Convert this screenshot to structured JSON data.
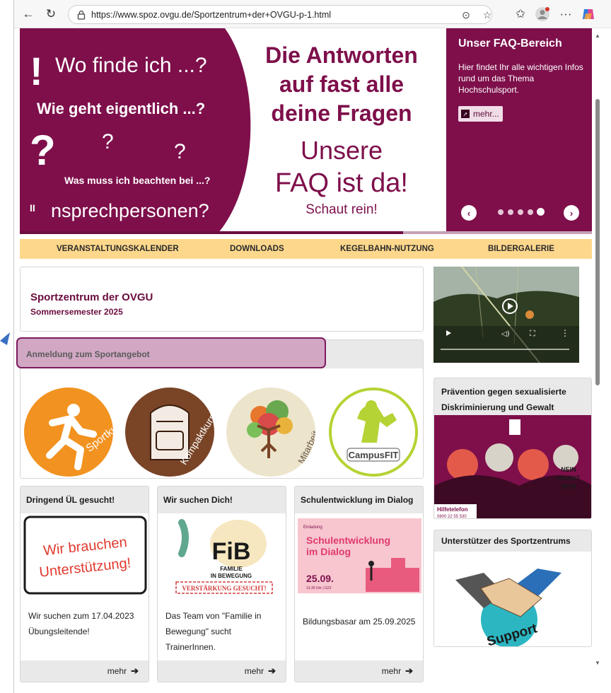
{
  "browser": {
    "url": "https://www.spoz.ovgu.de/Sportzentrum+der+OVGU-p-1.html"
  },
  "hero": {
    "line1": "Wo finde ich ...?",
    "line2": "Wie geht eigentlich ...?",
    "q_marks": [
      "?",
      "?",
      "?"
    ],
    "line3": "Was muss ich beachten bei ...?",
    "line4": "nsprechpersonen?",
    "exclaim": "!",
    "headline": [
      "Die Antworten",
      "auf fast alle",
      "deine Fragen"
    ],
    "faq_line1": "Unsere",
    "faq_line2": "FAQ ist da!",
    "faq_line3": "Schaut rein!",
    "pause_glyph": "II"
  },
  "faq_panel": {
    "title": "Unser FAQ-Bereich",
    "description": "Hier findet Ihr alle wichtigen Infos rund um das Thema Hochschulsport.",
    "more_label": "mehr...",
    "dots": 5,
    "active_dot": 4,
    "progress": 0.67
  },
  "nav": {
    "items": [
      "VERANSTALTUNGSKALENDER",
      "DOWNLOADS",
      "KEGELBAHN-NUTZUNG",
      "BILDERGALERIE"
    ]
  },
  "info": {
    "title": "Sportzentrum der OVGU",
    "subtitle": "Sommersemester 2025"
  },
  "anmeldung": {
    "title": "Anmeldung zum Sportangebot",
    "tiles": [
      {
        "label": "Sportkurse",
        "color": "#f29220"
      },
      {
        "label": "Kompaktkurs",
        "color": "#7a4426"
      },
      {
        "label": "Mitarbeiter",
        "color": "#ece5cc"
      },
      {
        "label": "CampusFIT",
        "color": "#ffffff"
      }
    ]
  },
  "right": {
    "praevention_title": "Prävention gegen sexualisierte Diskriminierung und Gewalt",
    "praevention_img_text": [
      "NEIN",
      "HEISST",
      "NEIN",
      "Hilfetelefon",
      "0800 22 55 530"
    ],
    "unterstuetzer_title": "Unterstützer des Sportzentrums",
    "support_label": "Support"
  },
  "cards": [
    {
      "title": "Dringend ÜL gesucht!",
      "img_text": [
        "Wir brauchen",
        "Unterstützung!"
      ],
      "text": "Wir suchen zum 17.04.2023 Übungsleitende!",
      "more": "mehr"
    },
    {
      "title": "Wir suchen Dich!",
      "img_text": [
        "FiB",
        "FAMILIE",
        "IN BEWEGUNG",
        "VERSTÄRKUNG GESUCHT!"
      ],
      "text": "Das Team von \"Familie in Bewegung\" sucht TrainerInnen.",
      "more": "mehr"
    },
    {
      "title": "Schulentwicklung im Dialog",
      "img_text": [
        "Einladung",
        "Schulentwicklung",
        "im Dialog",
        "25.09.",
        "13.30 Uhr | G22"
      ],
      "text": "Bildungsbasar am 25.09.2025",
      "more": "mehr"
    }
  ],
  "colors": {
    "brand": "#7e0f4b",
    "nav_bg": "#fdd88c",
    "card_head": "#e9e9ea"
  }
}
